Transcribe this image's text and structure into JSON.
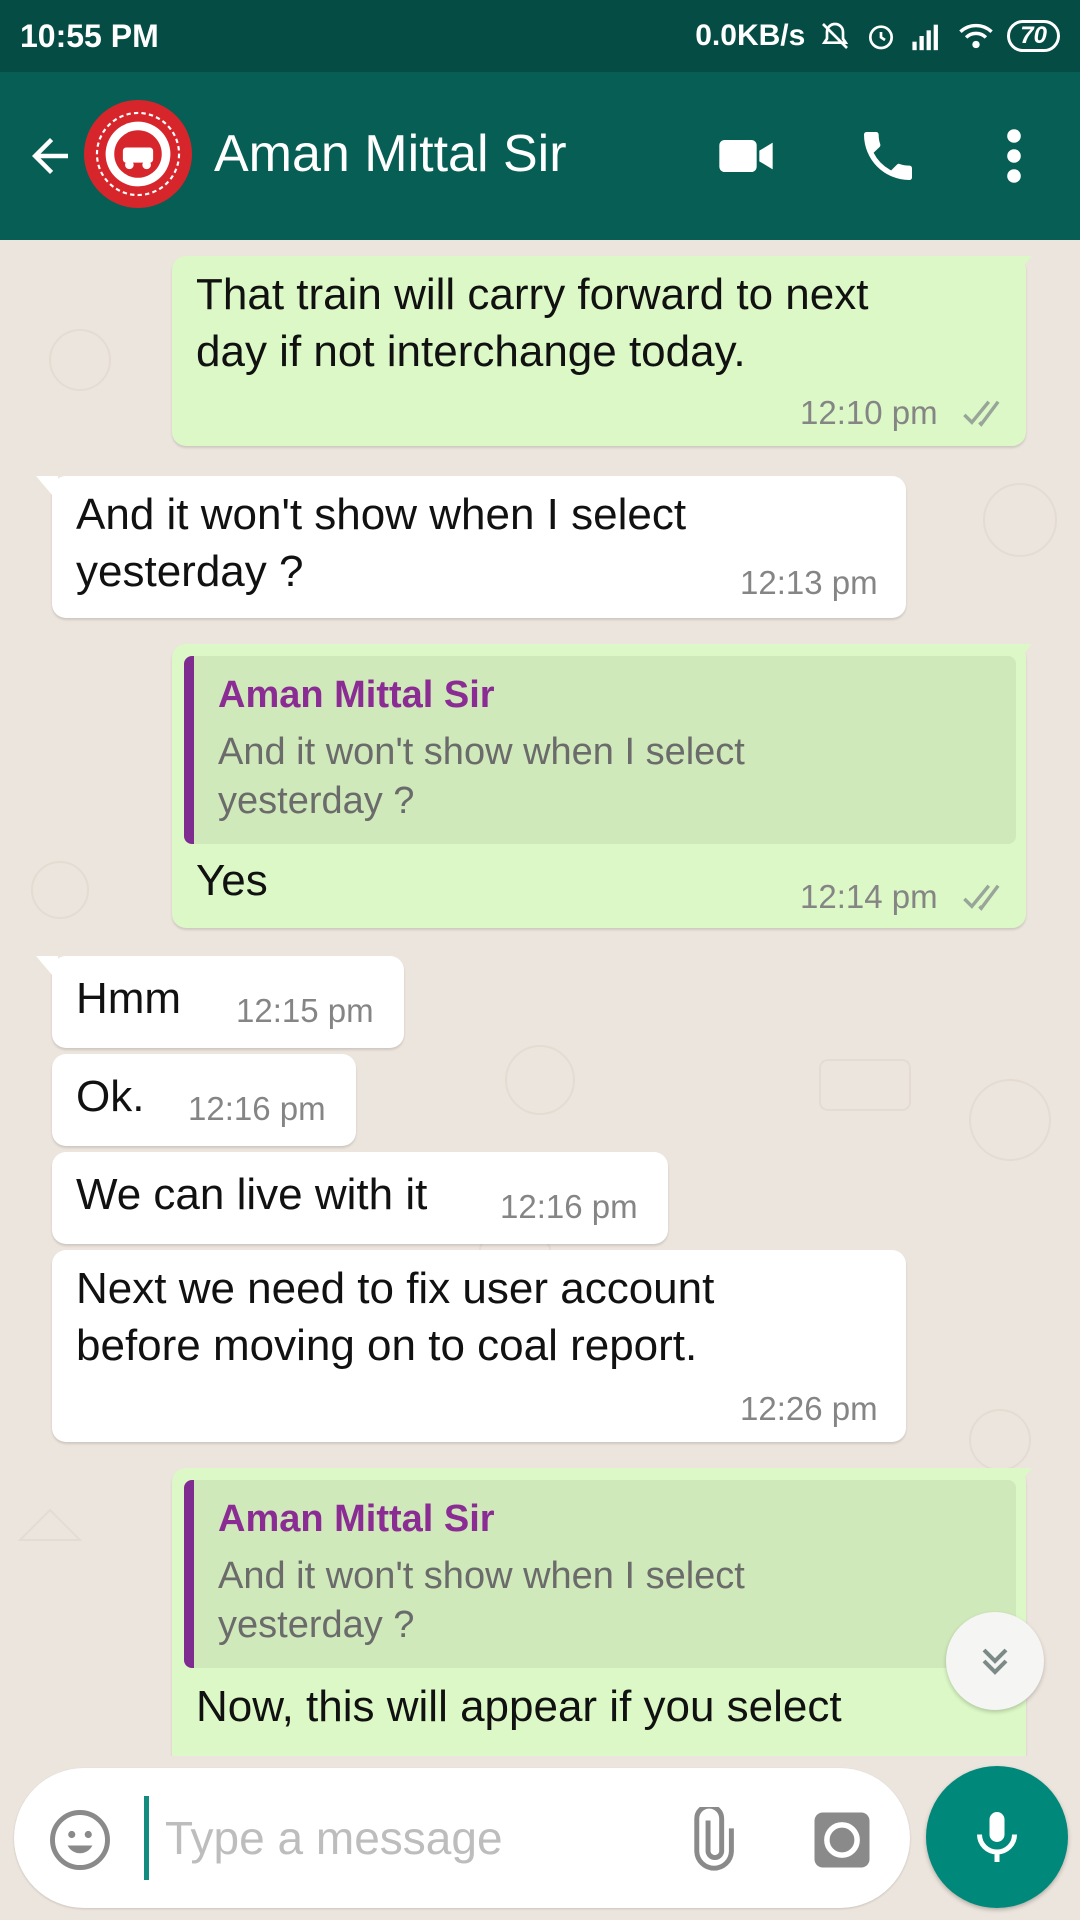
{
  "status_bar": {
    "time": "10:55 PM",
    "network_speed": "0.0KB/s",
    "battery": "70"
  },
  "header": {
    "contact_name": "Aman Mittal Sir",
    "avatar_icon": "indian-railways-logo",
    "actions": [
      "video-call-icon",
      "voice-call-icon",
      "more-options-icon"
    ]
  },
  "messages": [
    {
      "dir": "out",
      "lines": [
        "That train will carry forward to next",
        "day if not interchange today."
      ],
      "time": "12:10 pm",
      "status": "read"
    },
    {
      "dir": "in",
      "lines": [
        "And it won't show when I select",
        "yesterday ?"
      ],
      "time": "12:13 pm"
    },
    {
      "dir": "out",
      "quote_author": "Aman Mittal Sir",
      "quote_lines": [
        "And it won't show when I select",
        "yesterday ?"
      ],
      "lines": [
        "Yes"
      ],
      "time": "12:14 pm",
      "status": "read"
    },
    {
      "dir": "in",
      "lines": [
        "Hmm"
      ],
      "time": "12:15 pm"
    },
    {
      "dir": "in",
      "lines": [
        "Ok."
      ],
      "time": "12:16 pm"
    },
    {
      "dir": "in",
      "lines": [
        "We can live with it"
      ],
      "time": "12:16 pm"
    },
    {
      "dir": "in",
      "lines": [
        "Next we need to fix user account",
        "before moving on to coal report."
      ],
      "time": "12:26 pm"
    },
    {
      "dir": "out",
      "quote_author": "Aman Mittal Sir",
      "quote_lines": [
        "And it won't show when I select",
        "yesterday ?"
      ],
      "lines": [
        "Now, this will appear if you select"
      ]
    }
  ],
  "composer": {
    "placeholder": "Type a message",
    "value": ""
  },
  "colors": {
    "header": "#075e54",
    "status_bar": "#054d44",
    "outgoing_bubble": "#dcf8c6",
    "incoming_bubble": "#ffffff",
    "accent": "#00897b",
    "quote_author": "#8a2c93",
    "read_ticks": "#9aa59a"
  }
}
